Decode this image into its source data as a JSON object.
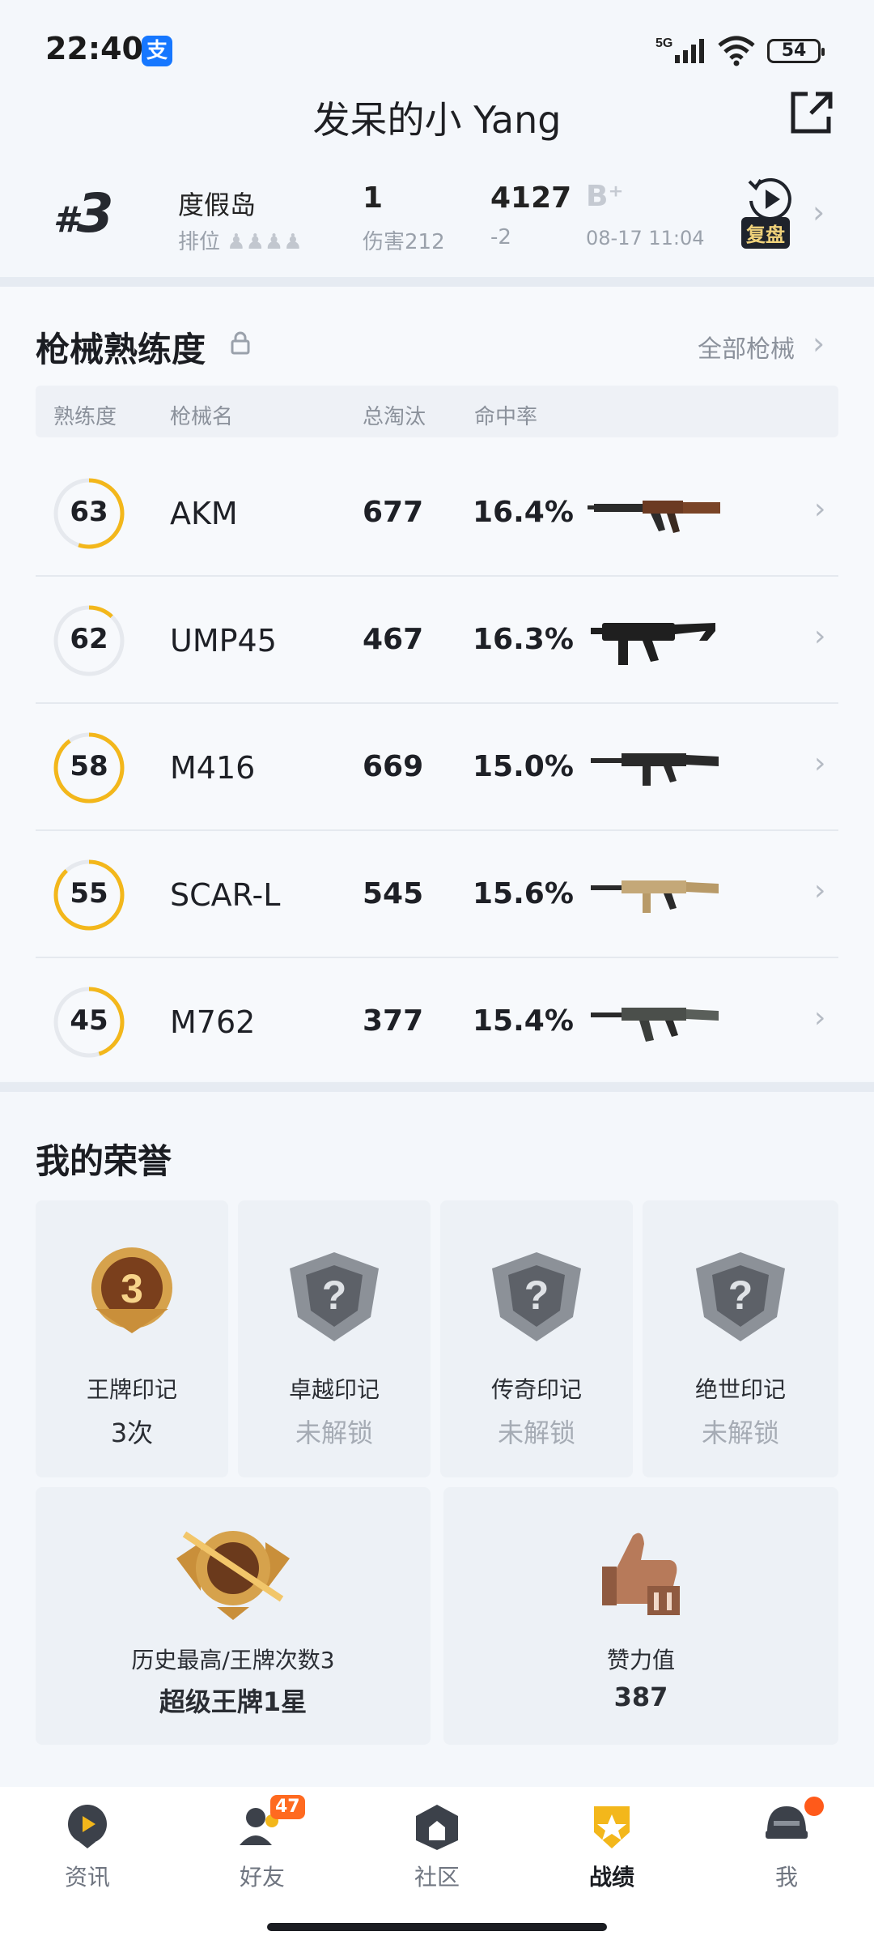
{
  "status": {
    "time": "22:40",
    "alipay_glyph": "支",
    "network": "5G",
    "battery": "54"
  },
  "header": {
    "title": "发呆的小 Yang"
  },
  "last_match": {
    "rank_prefix": "#",
    "rank": "3",
    "map": "度假岛",
    "mode": "排位",
    "kills": "1",
    "damage": "伤害212",
    "score": "4127",
    "score_delta": "-2",
    "grade": "B⁺",
    "time": "08-17 11:04",
    "replay_label": "复盘"
  },
  "weapons": {
    "title": "枪械熟练度",
    "all_link": "全部枪械",
    "headers": [
      "熟练度",
      "枪械名",
      "总淘汰",
      "命中率"
    ],
    "rows": [
      {
        "level": "63",
        "name": "AKM",
        "kills": "677",
        "hit_rate": "16.4%",
        "progress": 0.55
      },
      {
        "level": "62",
        "name": "UMP45",
        "kills": "467",
        "hit_rate": "16.3%",
        "progress": 0.12
      },
      {
        "level": "58",
        "name": "M416",
        "kills": "669",
        "hit_rate": "15.0%",
        "progress": 0.9
      },
      {
        "level": "55",
        "name": "SCAR-L",
        "kills": "545",
        "hit_rate": "15.6%",
        "progress": 0.88
      },
      {
        "level": "45",
        "name": "M762",
        "kills": "377",
        "hit_rate": "15.4%",
        "progress": 0.45
      }
    ]
  },
  "honors": {
    "title": "我的荣誉",
    "badges": [
      {
        "label": "王牌印记",
        "value": "3次",
        "locked": false,
        "emblem_num": "3"
      },
      {
        "label": "卓越印记",
        "value": "未解锁",
        "locked": true,
        "emblem_num": "?"
      },
      {
        "label": "传奇印记",
        "value": "未解锁",
        "locked": true,
        "emblem_num": "?"
      },
      {
        "label": "绝世印记",
        "value": "未解锁",
        "locked": true,
        "emblem_num": "?"
      }
    ],
    "highest": {
      "label": "历史最高/王牌次数3",
      "value": "超级王牌1星"
    },
    "effort": {
      "label": "赞力值",
      "value": "387"
    }
  },
  "nav": {
    "items": [
      {
        "label": "资讯"
      },
      {
        "label": "好友",
        "badge": "47"
      },
      {
        "label": "社区"
      },
      {
        "label": "战绩",
        "active": true
      },
      {
        "label": "我"
      }
    ]
  },
  "colors": {
    "accent_ring": "#f3b71b",
    "ring_track": "#e6e9ee",
    "badge": "#ff6a20"
  }
}
